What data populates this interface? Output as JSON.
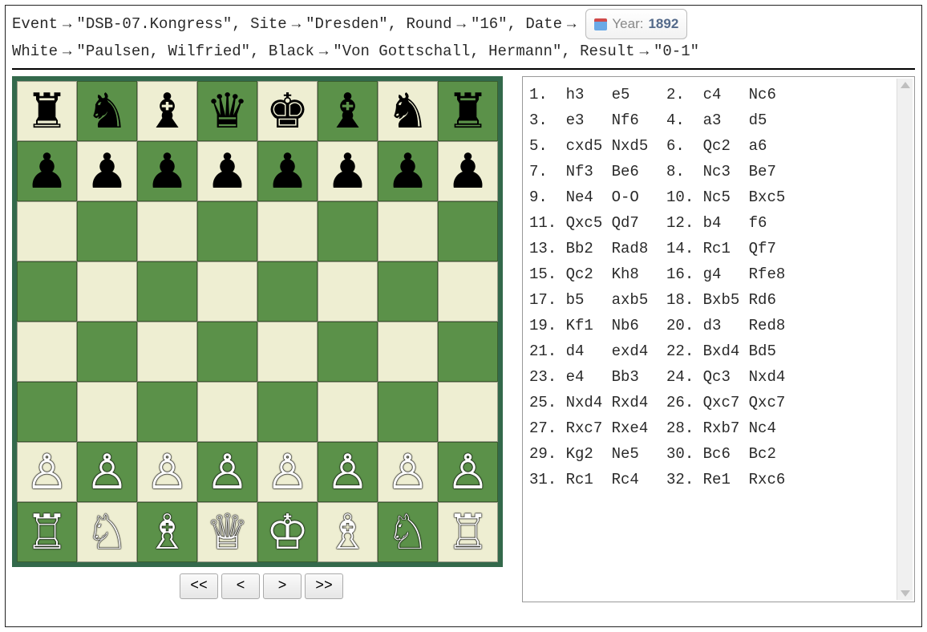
{
  "header": {
    "labels": {
      "event": "Event",
      "site": "Site",
      "round": "Round",
      "date": "Date",
      "white": "White",
      "black": "Black",
      "result": "Result"
    },
    "arrow": "→",
    "event": "\"DSB-07.Kongress\"",
    "site": "\"Dresden\"",
    "round": "\"16\"",
    "yearLabel": "Year:",
    "year": "1892",
    "white": "\"Paulsen, Wilfried\"",
    "black": "\"Von Gottschall, Hermann\"",
    "result": "\"0-1\""
  },
  "controls": {
    "first": "<<",
    "prev": "<",
    "next": ">",
    "last": ">>"
  },
  "board": {
    "position": "rnbqkbnr/pppppppp/8/8/8/8/PPPPPPPP/RNBQKBNR"
  },
  "moves": [
    {
      "n": 1,
      "w": "h3",
      "b": "e5"
    },
    {
      "n": 2,
      "w": "c4",
      "b": "Nc6"
    },
    {
      "n": 3,
      "w": "e3",
      "b": "Nf6"
    },
    {
      "n": 4,
      "w": "a3",
      "b": "d5"
    },
    {
      "n": 5,
      "w": "cxd5",
      "b": "Nxd5"
    },
    {
      "n": 6,
      "w": "Qc2",
      "b": "a6"
    },
    {
      "n": 7,
      "w": "Nf3",
      "b": "Be6"
    },
    {
      "n": 8,
      "w": "Nc3",
      "b": "Be7"
    },
    {
      "n": 9,
      "w": "Ne4",
      "b": "O-O"
    },
    {
      "n": 10,
      "w": "Nc5",
      "b": "Bxc5"
    },
    {
      "n": 11,
      "w": "Qxc5",
      "b": "Qd7"
    },
    {
      "n": 12,
      "w": "b4",
      "b": "f6"
    },
    {
      "n": 13,
      "w": "Bb2",
      "b": "Rad8"
    },
    {
      "n": 14,
      "w": "Rc1",
      "b": "Qf7"
    },
    {
      "n": 15,
      "w": "Qc2",
      "b": "Kh8"
    },
    {
      "n": 16,
      "w": "g4",
      "b": "Rfe8"
    },
    {
      "n": 17,
      "w": "b5",
      "b": "axb5"
    },
    {
      "n": 18,
      "w": "Bxb5",
      "b": "Rd6"
    },
    {
      "n": 19,
      "w": "Kf1",
      "b": "Nb6"
    },
    {
      "n": 20,
      "w": "d3",
      "b": "Red8"
    },
    {
      "n": 21,
      "w": "d4",
      "b": "exd4"
    },
    {
      "n": 22,
      "w": "Bxd4",
      "b": "Bd5"
    },
    {
      "n": 23,
      "w": "e4",
      "b": "Bb3"
    },
    {
      "n": 24,
      "w": "Qc3",
      "b": "Nxd4"
    },
    {
      "n": 25,
      "w": "Nxd4",
      "b": "Rxd4"
    },
    {
      "n": 26,
      "w": "Qxc7",
      "b": "Qxc7"
    },
    {
      "n": 27,
      "w": "Rxc7",
      "b": "Rxe4"
    },
    {
      "n": 28,
      "w": "Rxb7",
      "b": "Nc4"
    },
    {
      "n": 29,
      "w": "Kg2",
      "b": "Ne5"
    },
    {
      "n": 30,
      "w": "Bc6",
      "b": "Bc2"
    },
    {
      "n": 31,
      "w": "Rc1",
      "b": "Rc4"
    },
    {
      "n": 32,
      "w": "Re1",
      "b": "Rxc6"
    }
  ]
}
